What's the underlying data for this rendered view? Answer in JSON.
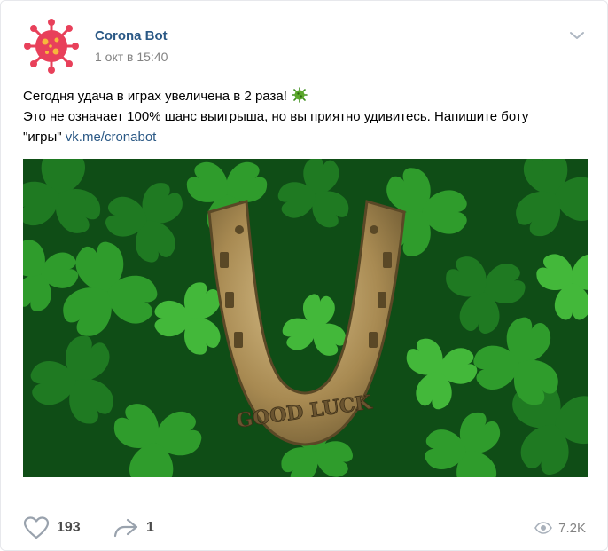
{
  "post": {
    "author": "Corona Bot",
    "date": "1 окт в 15:40",
    "avatar_icon": "coronavirus-icon",
    "text": {
      "line1": "Сегодня удача в играх увеличена в 2 раза!",
      "line1_emoji": "microbe-emoji",
      "line2": "Это не означает 100% шанс выигрыша, но вы приятно удивитесь. Напишите боту",
      "line3_quote": "\"игры\"",
      "line3_link": "vk.me/cronabot"
    },
    "image": {
      "caption_on_image": "GOOD LUCK"
    },
    "footer": {
      "likes": "193",
      "shares": "1",
      "views": "7.2K"
    },
    "colors": {
      "link": "#2a5885",
      "meta": "#828282",
      "icon": "#99a2ad",
      "avatar": "#e8405a",
      "clover": "#2e9b2e",
      "horseshoe": "#b8975a"
    }
  }
}
